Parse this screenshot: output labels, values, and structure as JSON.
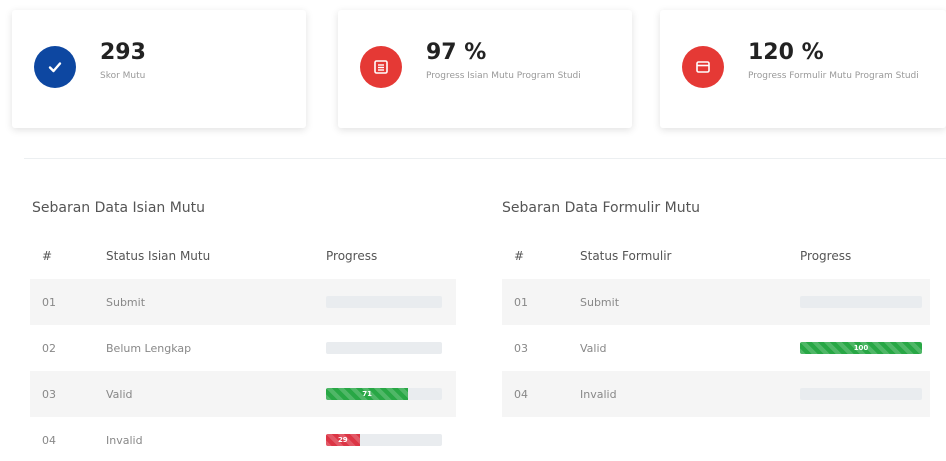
{
  "cards": [
    {
      "value": "293",
      "label": "Skor Mutu",
      "color": "#0d47a1",
      "icon": "check-icon"
    },
    {
      "value": "97 %",
      "label": "Progress Isian Mutu Program Studi",
      "color": "#e53935",
      "icon": "list-icon"
    },
    {
      "value": "120 %",
      "label": "Progress Formulir Mutu Program Studi",
      "color": "#e53935",
      "icon": "window-icon"
    }
  ],
  "isian": {
    "title": "Sebaran Data Isian Mutu",
    "headers": [
      "#",
      "Status Isian Mutu",
      "Progress"
    ],
    "rows": [
      {
        "no": "01",
        "status": "Submit",
        "progress": 0,
        "label": "",
        "color": "#28a745"
      },
      {
        "no": "02",
        "status": "Belum Lengkap",
        "progress": 0,
        "label": "",
        "color": "#28a745"
      },
      {
        "no": "03",
        "status": "Valid",
        "progress": 71,
        "label": "71",
        "color": "#28a745"
      },
      {
        "no": "04",
        "status": "Invalid",
        "progress": 29,
        "label": "29",
        "color": "#dc3545"
      }
    ]
  },
  "formulir": {
    "title": "Sebaran Data Formulir Mutu",
    "headers": [
      "#",
      "Status Formulir",
      "Progress"
    ],
    "rows": [
      {
        "no": "01",
        "status": "Submit",
        "progress": 0,
        "label": "",
        "color": "#28a745"
      },
      {
        "no": "03",
        "status": "Valid",
        "progress": 100,
        "label": "100",
        "color": "#28a745"
      },
      {
        "no": "04",
        "status": "Invalid",
        "progress": 0,
        "label": "",
        "color": "#28a745"
      }
    ]
  }
}
